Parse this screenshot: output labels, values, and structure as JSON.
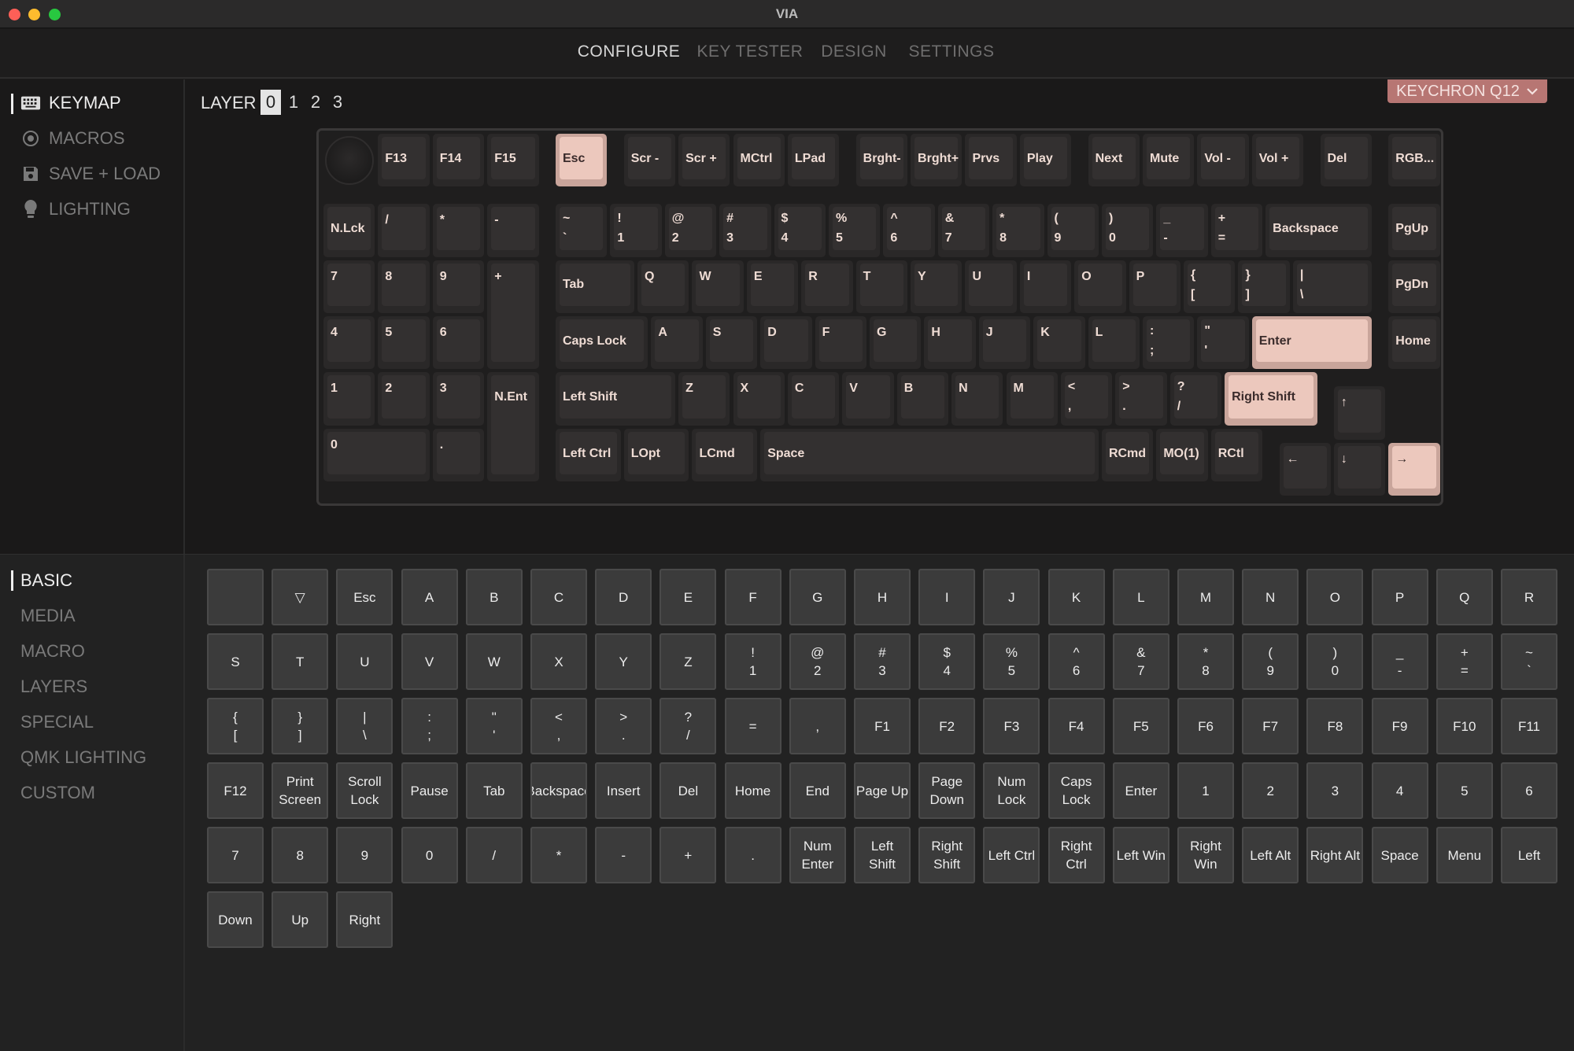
{
  "window": {
    "title": "VIA"
  },
  "nav": {
    "tabs": [
      "CONFIGURE",
      "KEY TESTER",
      "DESIGN",
      "SETTINGS"
    ],
    "active": 0
  },
  "sidebar_top": {
    "items": [
      "KEYMAP",
      "MACROS",
      "SAVE + LOAD",
      "LIGHTING"
    ],
    "active": 0
  },
  "layers": {
    "label": "LAYER",
    "options": [
      "0",
      "1",
      "2",
      "3"
    ],
    "active": 0
  },
  "device": {
    "name": "KEYCHRON Q12"
  },
  "keyboard": {
    "keys": [
      "F13",
      "F14",
      "F15",
      "Esc",
      "Scr -",
      "Scr +",
      "MCtrl",
      "LPad",
      "Brght-",
      "Brght+",
      "Prvs",
      "Play",
      "Next",
      "Mute",
      "Vol -",
      "Vol +",
      "Del",
      "RGB...",
      "N.Lck",
      "/",
      "*",
      "-",
      "~\n`",
      "!\n1",
      "@\n2",
      "#\n3",
      "$\n4",
      "%\n5",
      "^\n6",
      "&\n7",
      "*\n8",
      "(\n9",
      ")\n0",
      "_\n-",
      "+\n=",
      "Backspace",
      "PgUp",
      "7",
      "8",
      "9",
      "+",
      "Tab",
      "Q",
      "W",
      "E",
      "R",
      "T",
      "Y",
      "U",
      "I",
      "O",
      "P",
      "{\n[",
      "}\n]",
      "|\n\\",
      "PgDn",
      "4",
      "5",
      "6",
      "Caps Lock",
      "A",
      "S",
      "D",
      "F",
      "G",
      "H",
      "J",
      "K",
      "L",
      ":\n;",
      "\"\n'",
      "Enter",
      "Home",
      "1",
      "2",
      "3",
      "N.Ent",
      "Left Shift",
      "Z",
      "X",
      "C",
      "V",
      "B",
      "N",
      "M",
      "<\n,",
      ">\n.",
      "?\n/",
      "Right Shift",
      "↑",
      "0",
      ".",
      "Left Ctrl",
      "LOpt",
      "LCmd",
      "Space",
      "RCmd",
      "MO(1)",
      "RCtl",
      "←",
      "↓",
      "→"
    ]
  },
  "sidebar_bottom": {
    "items": [
      "BASIC",
      "MEDIA",
      "MACRO",
      "LAYERS",
      "SPECIAL",
      "QMK LIGHTING",
      "CUSTOM"
    ],
    "active": 0
  },
  "keycode_grid": {
    "keys": [
      "",
      "▽",
      "Esc",
      "A",
      "B",
      "C",
      "D",
      "E",
      "F",
      "G",
      "H",
      "I",
      "J",
      "K",
      "L",
      "M",
      "N",
      "O",
      "P",
      "Q",
      "R",
      "S",
      "T",
      "U",
      "V",
      "W",
      "X",
      "Y",
      "Z",
      "!\n1",
      "@\n2",
      "#\n3",
      "$\n4",
      "%\n5",
      "^\n6",
      "&\n7",
      "*\n8",
      "(\n9",
      ")\n0",
      "_\n-",
      "+\n=",
      "~\n`",
      "{\n[",
      "}\n]",
      "|\n\\",
      ":\n;",
      "\"\n'",
      "<\n,",
      ">\n.",
      "?\n/",
      "=",
      ",",
      "F1",
      "F2",
      "F3",
      "F4",
      "F5",
      "F6",
      "F7",
      "F8",
      "F9",
      "F10",
      "F11",
      "F12",
      "Print\nScreen",
      "Scroll\nLock",
      "Pause",
      "Tab",
      "Backspace",
      "Insert",
      "Del",
      "Home",
      "End",
      "Page Up",
      "Page\nDown",
      "Num\nLock",
      "Caps\nLock",
      "Enter",
      "1",
      "2",
      "3",
      "4",
      "5",
      "6",
      "7",
      "8",
      "9",
      "0",
      "/",
      "*",
      "-",
      "+",
      ".",
      "Num\nEnter",
      "Left\nShift",
      "Right\nShift",
      "Left Ctrl",
      "Right\nCtrl",
      "Left Win",
      "Right\nWin",
      "Left Alt",
      "Right Alt",
      "Space",
      "Menu",
      "Left",
      "Down",
      "Up",
      "Right"
    ]
  },
  "colors": {
    "accent": "#b77673",
    "keycap_accent": "#ecc8bd",
    "keycap": "#333030"
  }
}
